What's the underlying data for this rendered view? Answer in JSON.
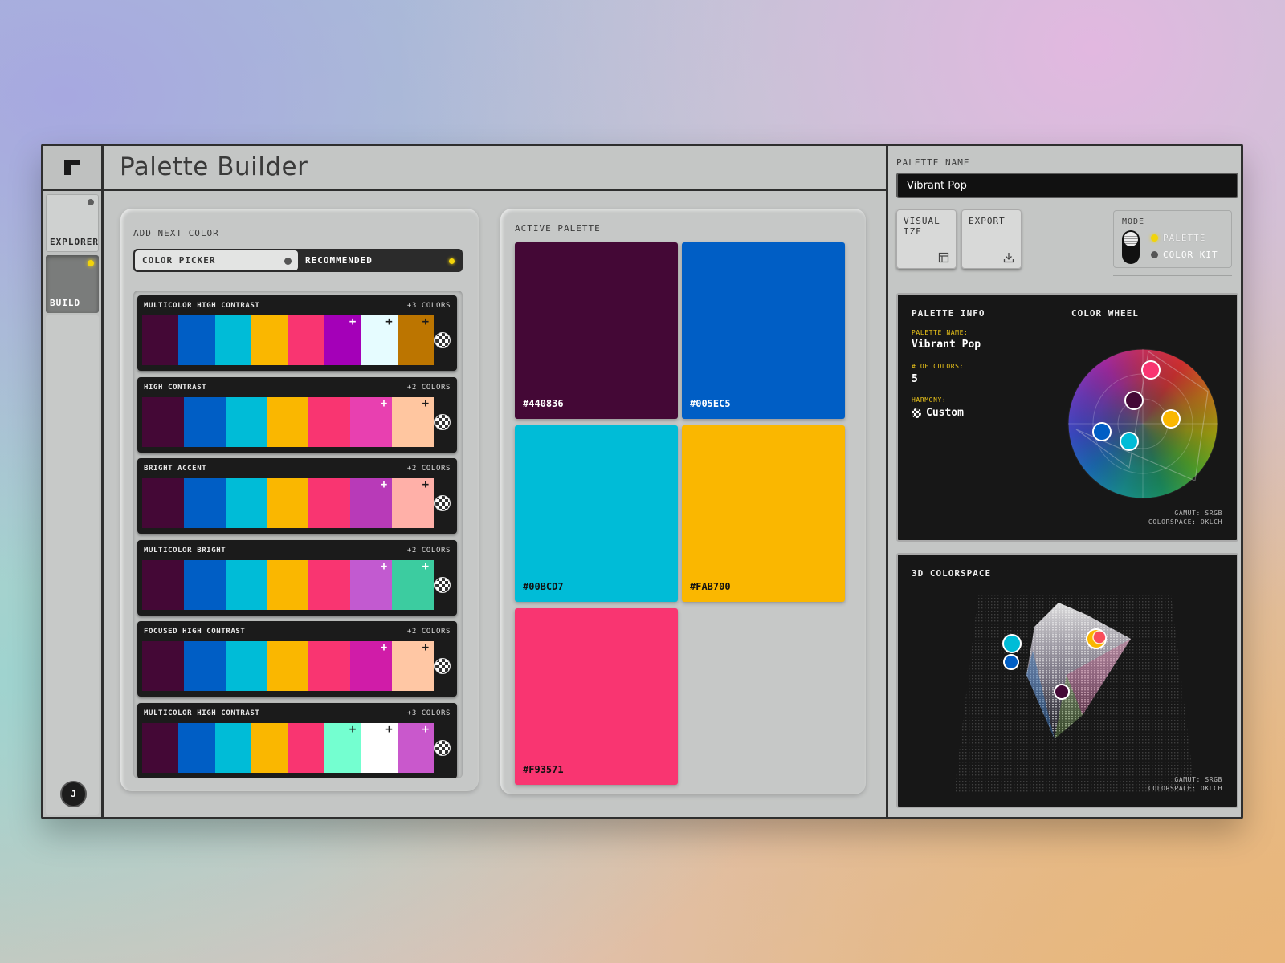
{
  "app": {
    "title": "Palette Builder"
  },
  "rail": {
    "items": [
      {
        "label": "EXPLORER",
        "active": false
      },
      {
        "label": "BUILD",
        "active": true
      }
    ],
    "avatar_initial": "J"
  },
  "add_panel": {
    "label": "ADD NEXT COLOR",
    "tabs": [
      {
        "label": "COLOR PICKER",
        "selected": false
      },
      {
        "label": "RECOMMENDED",
        "selected": true
      }
    ],
    "recommendations": [
      {
        "name": "MULTICOLOR HIGH CONTRAST",
        "count": "+3 COLORS",
        "colors": [
          "#440836",
          "#005EC5",
          "#00BCD7",
          "#FAB700",
          "#F93571",
          "#A400B8",
          "#E6FCFF",
          "#BC7500"
        ],
        "added": [
          5,
          6,
          7
        ]
      },
      {
        "name": "HIGH CONTRAST",
        "count": "+2 COLORS",
        "colors": [
          "#440836",
          "#005EC5",
          "#00BCD7",
          "#FAB700",
          "#F93571",
          "#E840B0",
          "#FFC6A0"
        ],
        "added": [
          5,
          6
        ]
      },
      {
        "name": "BRIGHT ACCENT",
        "count": "+2 COLORS",
        "colors": [
          "#440836",
          "#005EC5",
          "#00BCD7",
          "#FAB700",
          "#F93571",
          "#B83AB8",
          "#FFB0A8"
        ],
        "added": [
          5,
          6
        ]
      },
      {
        "name": "MULTICOLOR BRIGHT",
        "count": "+2 COLORS",
        "colors": [
          "#440836",
          "#005EC5",
          "#00BCD7",
          "#FAB700",
          "#F93571",
          "#C25AD0",
          "#3CCCA0"
        ],
        "added": [
          5,
          6
        ]
      },
      {
        "name": "FOCUSED HIGH CONTRAST",
        "count": "+2 COLORS",
        "colors": [
          "#440836",
          "#005EC5",
          "#00BCD7",
          "#FAB700",
          "#F93571",
          "#D01CA8",
          "#FFC7A4"
        ],
        "added": [
          5,
          6
        ]
      },
      {
        "name": "MULTICOLOR HIGH CONTRAST",
        "count": "+3 COLORS",
        "colors": [
          "#440836",
          "#005EC5",
          "#00BCD7",
          "#FAB700",
          "#F93571",
          "#74FFD0",
          "#FFFFFF",
          "#C958CC"
        ],
        "added": [
          5,
          6,
          7
        ]
      }
    ]
  },
  "active_palette": {
    "label": "ACTIVE PALETTE",
    "colors": [
      {
        "hex": "#440836",
        "text_light": true
      },
      {
        "hex": "#005EC5",
        "text_light": true
      },
      {
        "hex": "#00BCD7",
        "text_light": false
      },
      {
        "hex": "#FAB700",
        "text_light": false
      },
      {
        "hex": "#F93571",
        "text_light": false
      }
    ]
  },
  "right": {
    "palette_name_label": "PALETTE NAME",
    "palette_name_value": "Vibrant Pop",
    "buttons": [
      {
        "label": "VISUAL IZE",
        "icon": "layout-icon"
      },
      {
        "label": "EXPORT",
        "icon": "download-icon"
      }
    ],
    "mode": {
      "label": "MODE",
      "options": [
        {
          "label": "PALETTE",
          "selected": true
        },
        {
          "label": "COLOR KIT",
          "selected": false
        }
      ]
    },
    "info": {
      "title": "PALETTE INFO",
      "name_key": "PALETTE NAME:",
      "name_value": "Vibrant Pop",
      "count_key": "# OF COLORS:",
      "count_value": "5",
      "harmony_key": "HARMONY:",
      "harmony_value": "Custom"
    },
    "wheel": {
      "title": "COLOR WHEEL",
      "gamut": "GAMUT: SRGB",
      "colorspace": "COLORSPACE: OKLCH"
    },
    "space3d": {
      "title": "3D COLORSPACE",
      "gamut": "GAMUT: SRGB",
      "colorspace": "COLORSPACE: OKLCH"
    }
  },
  "colors": {
    "accent_led": "#f2d40a",
    "panel_bg": "#c6c8c7",
    "dark_bg": "#171717"
  }
}
